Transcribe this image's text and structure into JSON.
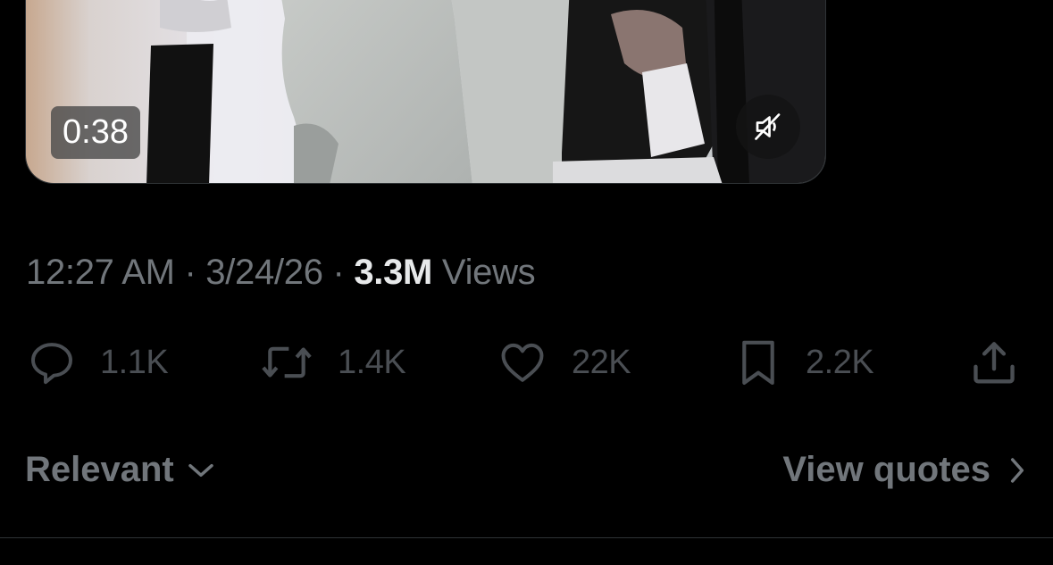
{
  "video": {
    "duration": "0:38",
    "mute_icon": "speaker-muted-icon"
  },
  "meta": {
    "time": "12:27 AM",
    "separator": "·",
    "date": "3/24/26",
    "views_count": "3.3M",
    "views_label": "Views"
  },
  "actions": {
    "reply": {
      "icon": "reply-bubble-icon",
      "count": "1.1K"
    },
    "repost": {
      "icon": "repost-arrows-icon",
      "count": "1.4K"
    },
    "like": {
      "icon": "heart-icon",
      "count": "22K"
    },
    "bookmark": {
      "icon": "bookmark-icon",
      "count": "2.2K"
    },
    "share": {
      "icon": "share-upload-icon"
    }
  },
  "replies_sort": {
    "label": "Relevant",
    "icon": "chevron-down-icon"
  },
  "view_quotes": {
    "label": "View quotes",
    "icon": "chevron-right-icon"
  },
  "colors": {
    "background": "#000000",
    "muted_text": "#71767b",
    "primary_text": "#e7e9ea",
    "action_count": "#4a4e53",
    "divider": "#2f3336"
  }
}
